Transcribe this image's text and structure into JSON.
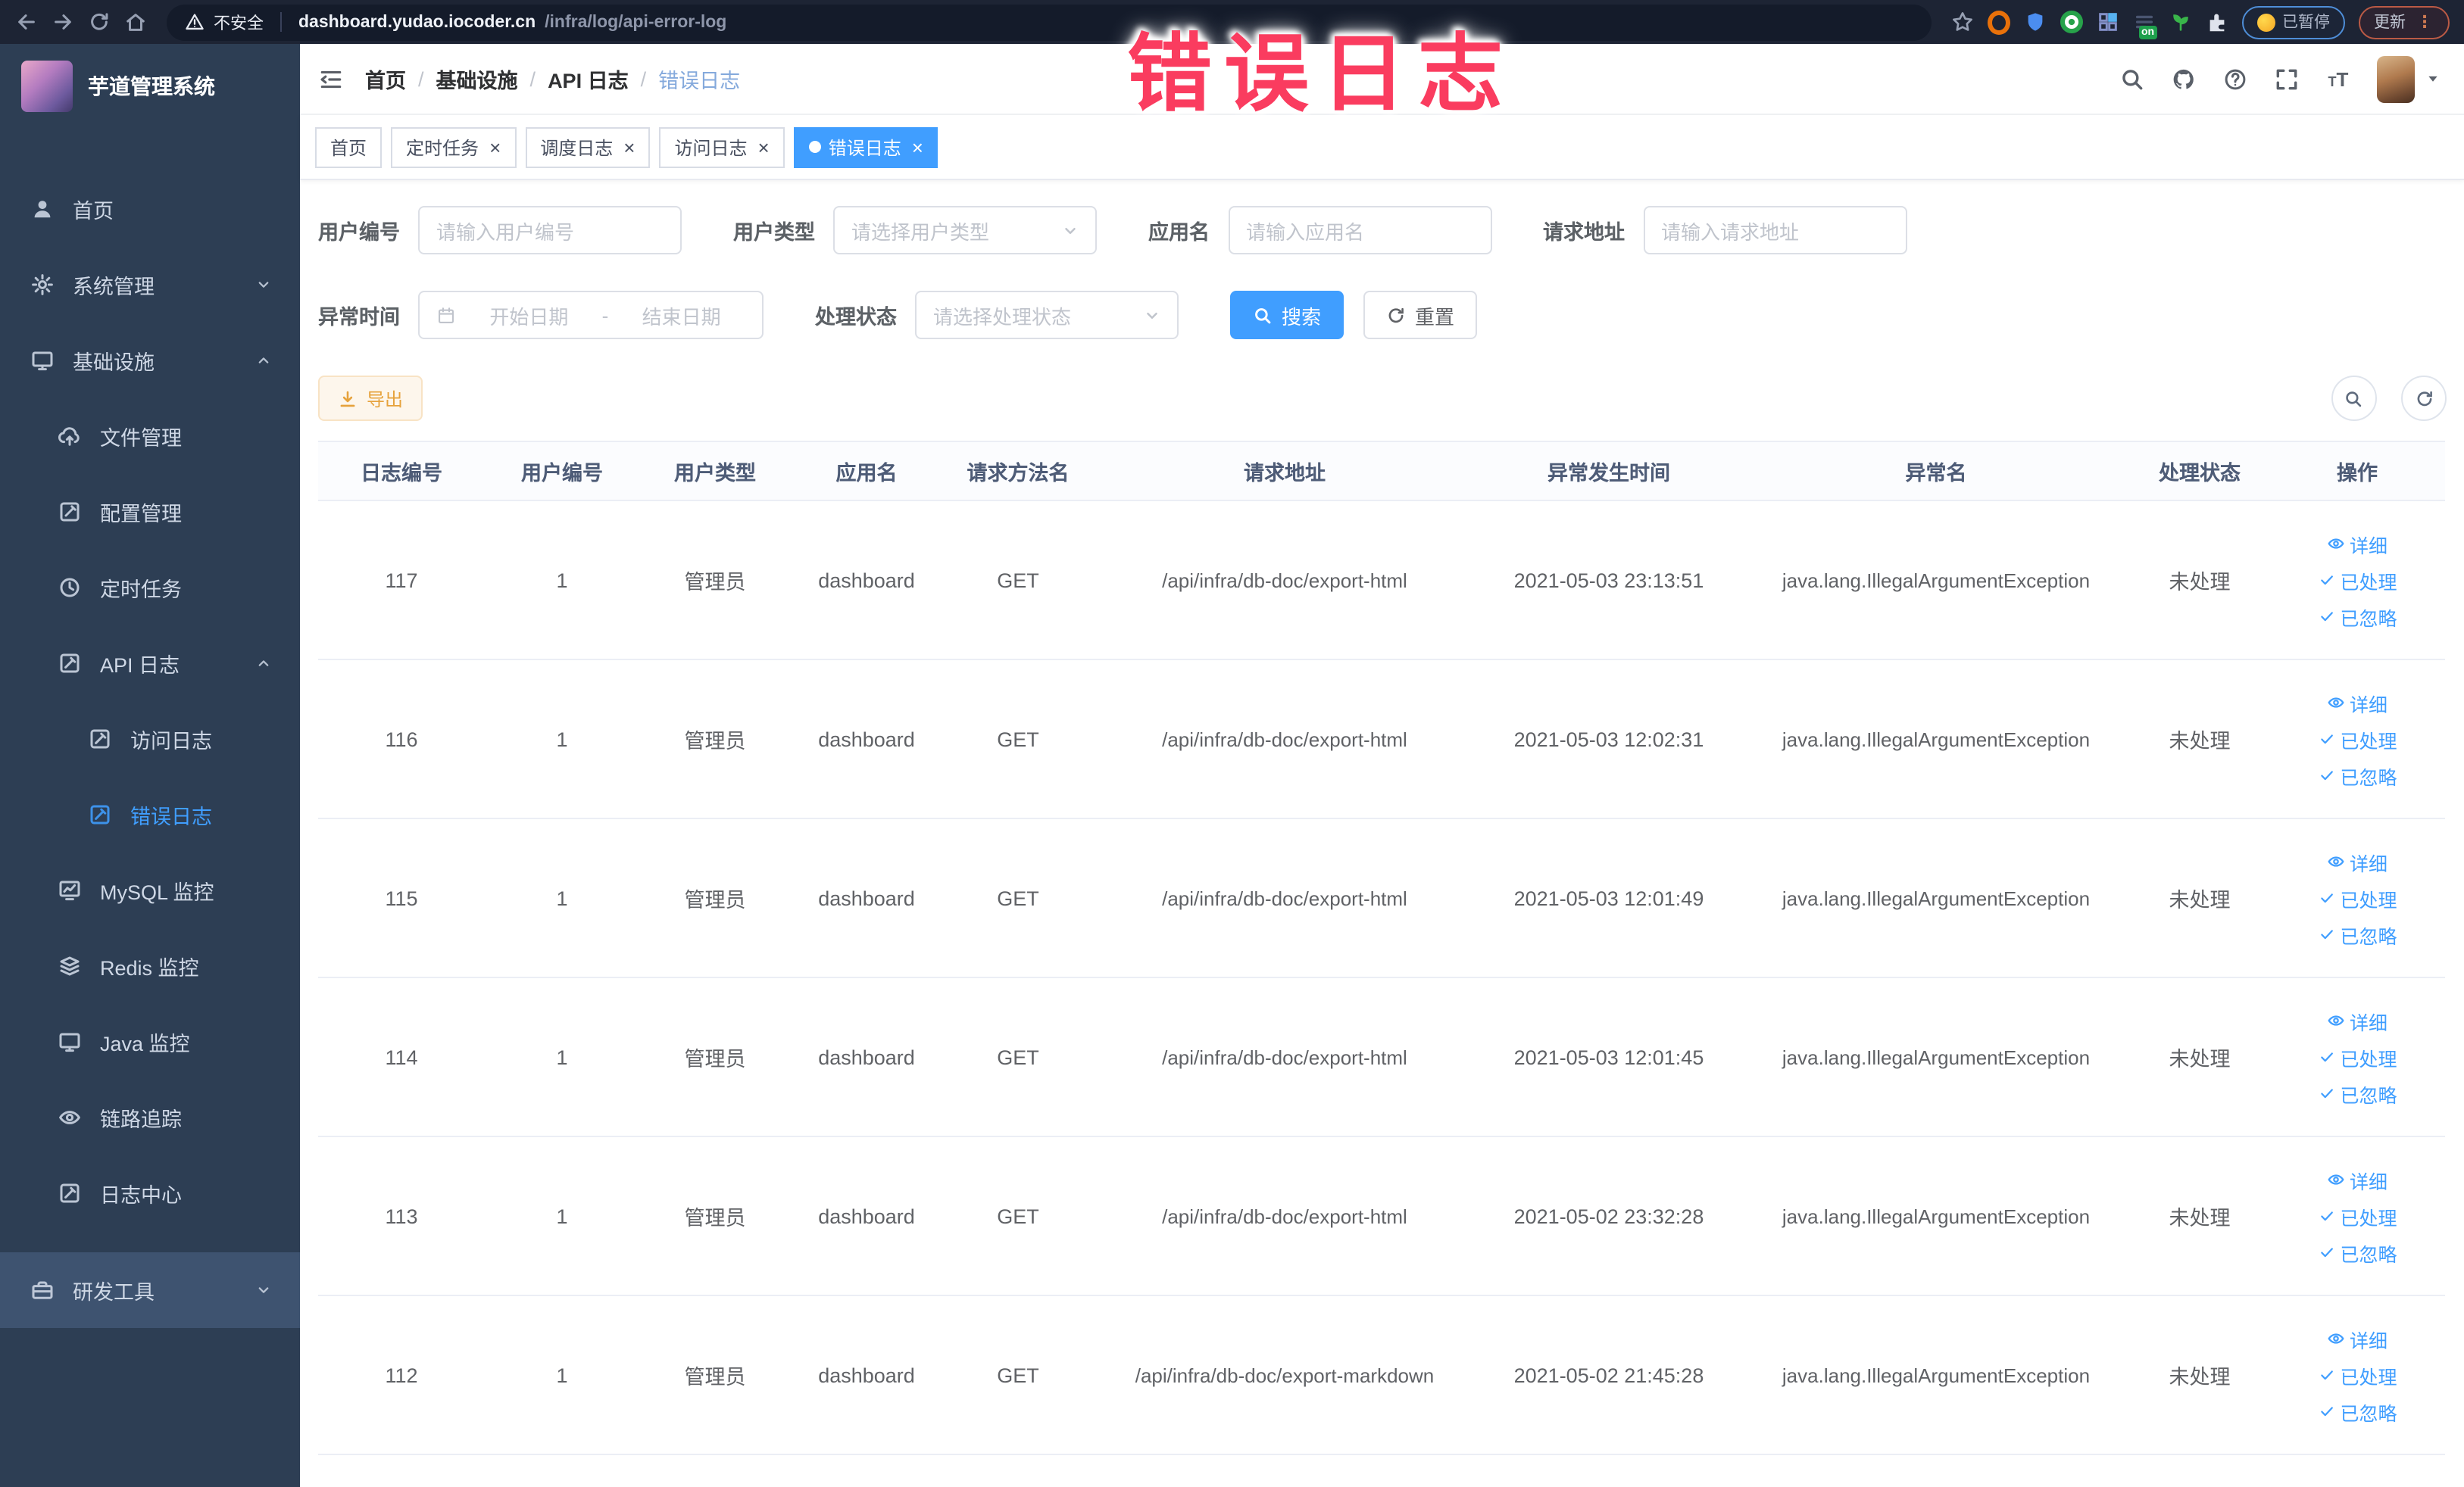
{
  "browser": {
    "security_label": "不安全",
    "url_host": "dashboard.yudao.iocoder.cn",
    "url_path": "/infra/log/api-error-log",
    "extension_on_badge": "on",
    "paused_badge": "已暂停",
    "update_button": "更新"
  },
  "annotation": {
    "text": "错误日志",
    "color": "#fa3c5f"
  },
  "sidebar": {
    "title": "芋道管理系统",
    "items": [
      {
        "label": "首页",
        "icon": "user-icon",
        "level": 1
      },
      {
        "label": "系统管理",
        "icon": "gear-icon",
        "level": 1,
        "arrow": "down"
      },
      {
        "label": "基础设施",
        "icon": "monitor-icon",
        "level": 1,
        "arrow": "up"
      },
      {
        "label": "文件管理",
        "icon": "cloud-upload-icon",
        "level": 2
      },
      {
        "label": "配置管理",
        "icon": "edit-square-icon",
        "level": 2
      },
      {
        "label": "定时任务",
        "icon": "clock-icon",
        "level": 2
      },
      {
        "label": "API 日志",
        "icon": "log-icon",
        "level": 2,
        "arrow": "up"
      },
      {
        "label": "访问日志",
        "icon": "log-icon",
        "level": 3
      },
      {
        "label": "错误日志",
        "icon": "log-icon",
        "level": 3,
        "active": true
      },
      {
        "label": "MySQL 监控",
        "icon": "chart-icon",
        "level": 2
      },
      {
        "label": "Redis 监控",
        "icon": "stack-icon",
        "level": 2
      },
      {
        "label": "Java 监控",
        "icon": "monitor-icon",
        "level": 2
      },
      {
        "label": "链路追踪",
        "icon": "eye-icon",
        "level": 2
      },
      {
        "label": "日志中心",
        "icon": "log-icon",
        "level": 2
      },
      {
        "label": "研发工具",
        "icon": "toolbox-icon",
        "level": 1,
        "arrow": "down",
        "hover": true
      }
    ]
  },
  "breadcrumb": [
    "首页",
    "基础设施",
    "API 日志",
    "错误日志"
  ],
  "tags": [
    {
      "label": "首页",
      "closable": false,
      "active": false
    },
    {
      "label": "定时任务",
      "closable": true,
      "active": false
    },
    {
      "label": "调度日志",
      "closable": true,
      "active": false
    },
    {
      "label": "访问日志",
      "closable": true,
      "active": false
    },
    {
      "label": "错误日志",
      "closable": true,
      "active": true
    }
  ],
  "filters": {
    "row1": [
      {
        "label": "用户编号",
        "type": "input",
        "placeholder": "请输入用户编号"
      },
      {
        "label": "用户类型",
        "type": "select",
        "placeholder": "请选择用户类型"
      },
      {
        "label": "应用名",
        "type": "input",
        "placeholder": "请输入应用名"
      },
      {
        "label": "请求地址",
        "type": "input",
        "placeholder": "请输入请求地址"
      }
    ],
    "time_label": "异常时间",
    "date_start_placeholder": "开始日期",
    "date_separator": "-",
    "date_end_placeholder": "结束日期",
    "status_label": "处理状态",
    "status_placeholder": "请选择处理状态",
    "search_button": "搜索",
    "reset_button": "重置"
  },
  "toolbar": {
    "export_button": "导出"
  },
  "table": {
    "columns": [
      "日志编号",
      "用户编号",
      "用户类型",
      "应用名",
      "请求方法名",
      "请求地址",
      "异常发生时间",
      "异常名",
      "处理状态",
      "操作"
    ],
    "actions": [
      "详细",
      "已处理",
      "已忽略"
    ],
    "rows": [
      {
        "id": "117",
        "user_id": "1",
        "user_type": "管理员",
        "app": "dashboard",
        "method": "GET",
        "url": "/api/infra/db-doc/export-html",
        "time": "2021-05-03 23:13:51",
        "exception": "java.lang.IllegalArgumentException",
        "status": "未处理"
      },
      {
        "id": "116",
        "user_id": "1",
        "user_type": "管理员",
        "app": "dashboard",
        "method": "GET",
        "url": "/api/infra/db-doc/export-html",
        "time": "2021-05-03 12:02:31",
        "exception": "java.lang.IllegalArgumentException",
        "status": "未处理"
      },
      {
        "id": "115",
        "user_id": "1",
        "user_type": "管理员",
        "app": "dashboard",
        "method": "GET",
        "url": "/api/infra/db-doc/export-html",
        "time": "2021-05-03 12:01:49",
        "exception": "java.lang.IllegalArgumentException",
        "status": "未处理"
      },
      {
        "id": "114",
        "user_id": "1",
        "user_type": "管理员",
        "app": "dashboard",
        "method": "GET",
        "url": "/api/infra/db-doc/export-html",
        "time": "2021-05-03 12:01:45",
        "exception": "java.lang.IllegalArgumentException",
        "status": "未处理"
      },
      {
        "id": "113",
        "user_id": "1",
        "user_type": "管理员",
        "app": "dashboard",
        "method": "GET",
        "url": "/api/infra/db-doc/export-html",
        "time": "2021-05-02 23:32:28",
        "exception": "java.lang.IllegalArgumentException",
        "status": "未处理"
      },
      {
        "id": "112",
        "user_id": "1",
        "user_type": "管理员",
        "app": "dashboard",
        "method": "GET",
        "url": "/api/infra/db-doc/export-markdown",
        "time": "2021-05-02 21:45:28",
        "exception": "java.lang.IllegalArgumentException",
        "status": "未处理"
      }
    ]
  },
  "colors": {
    "primary": "#409EFF",
    "warning": "#e6a23c",
    "sidebar_bg": "#2d3e54",
    "annotation": "#fa3c5f"
  }
}
